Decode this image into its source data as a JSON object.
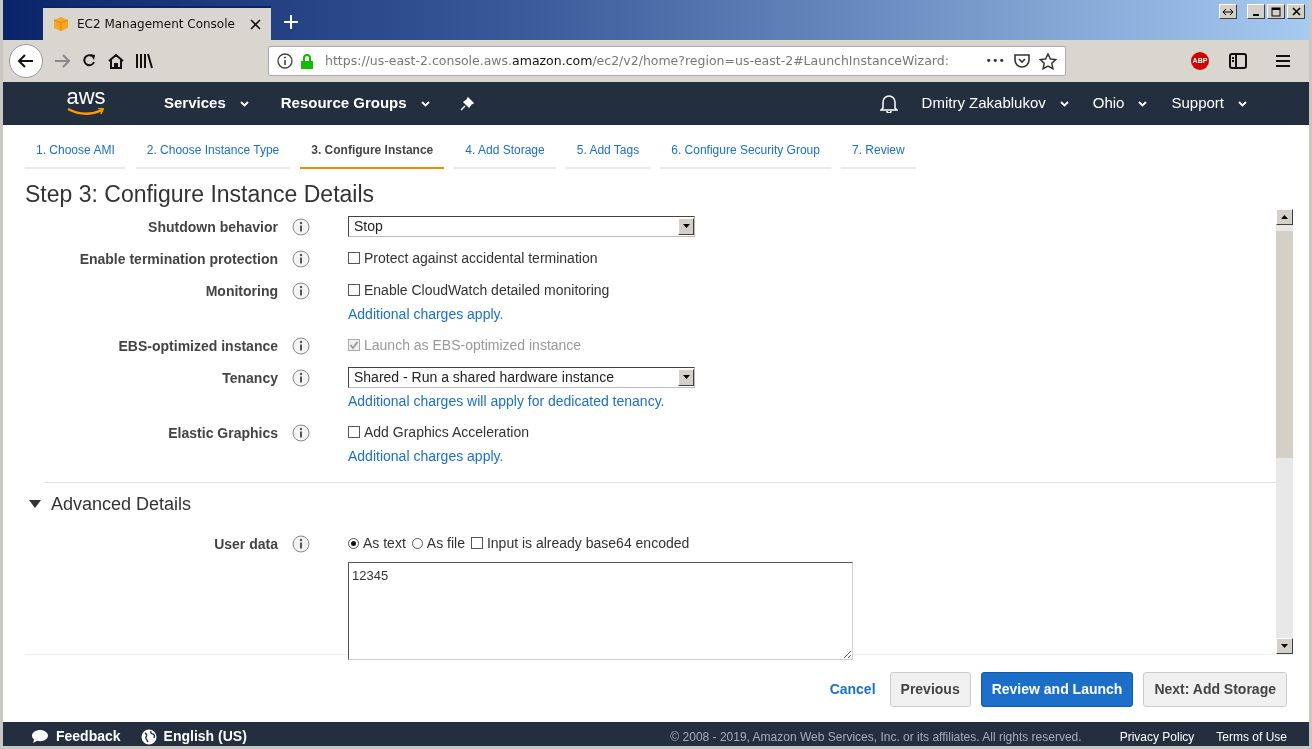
{
  "browser": {
    "tabs": [
      {
        "title": "EC2 Management Console",
        "selected": true
      }
    ],
    "url_parts": [
      {
        "text": "https://us-east-2.console.aws.",
        "emphasized": false
      },
      {
        "text": "amazon.com",
        "emphasized": true
      },
      {
        "text": "/ec2/v2/home?region=us-east-2#LaunchInstanceWizard:",
        "emphasized": false
      }
    ],
    "page_actions": "•••",
    "extension_badge": "ABP"
  },
  "aws_nav": {
    "logo": "aws",
    "menus": [
      {
        "label": "Services"
      },
      {
        "label": "Resource Groups"
      }
    ],
    "account_menus": [
      {
        "label": "Dmitry Zakablukov"
      },
      {
        "label": "Ohio"
      },
      {
        "label": "Support"
      }
    ]
  },
  "wizard_steps": [
    {
      "label": "1. Choose AMI",
      "selected": false
    },
    {
      "label": "2. Choose Instance Type",
      "selected": false
    },
    {
      "label": "3. Configure Instance",
      "selected": true
    },
    {
      "label": "4. Add Storage",
      "selected": false
    },
    {
      "label": "5. Add Tags",
      "selected": false
    },
    {
      "label": "6. Configure Security Group",
      "selected": false
    },
    {
      "label": "7. Review",
      "selected": false
    }
  ],
  "heading": "Step 3: Configure Instance Details",
  "form_rows": [
    {
      "label": "Shutdown behavior",
      "kind": "select",
      "value": "Stop"
    },
    {
      "label": "Enable termination protection",
      "kind": "checkbox",
      "option": "Protect against accidental termination",
      "checked": false,
      "disabled": false
    },
    {
      "label": "Monitoring",
      "kind": "checkbox",
      "option": "Enable CloudWatch detailed monitoring",
      "checked": false,
      "disabled": false,
      "note": "Additional charges apply."
    },
    {
      "label": "EBS-optimized instance",
      "kind": "checkbox",
      "option": "Launch as EBS-optimized instance",
      "checked": true,
      "disabled": true
    },
    {
      "label": "Tenancy",
      "kind": "select",
      "value": "Shared - Run a shared hardware instance",
      "note": "Additional charges will apply for dedicated tenancy."
    },
    {
      "label": "Elastic Graphics",
      "kind": "checkbox",
      "option": "Add Graphics Acceleration",
      "checked": false,
      "disabled": false,
      "note": "Additional charges apply."
    }
  ],
  "advanced": {
    "title": "Advanced Details",
    "expanded": true,
    "user_data": {
      "label": "User data",
      "options": [
        {
          "kind": "radio",
          "label": "As text",
          "selected": true
        },
        {
          "kind": "radio",
          "label": "As file",
          "selected": false
        },
        {
          "kind": "checkbox",
          "label": "Input is already base64 encoded",
          "checked": false
        }
      ],
      "value": "12345"
    }
  },
  "actions": {
    "cancel": "Cancel",
    "buttons": [
      {
        "label": "Previous",
        "kind": "secondary"
      },
      {
        "label": "Review and Launch",
        "kind": "primary"
      },
      {
        "label": "Next: Add Storage",
        "kind": "secondary"
      }
    ]
  },
  "footer": {
    "feedback": "Feedback",
    "language": "English (US)",
    "copyright": "© 2008 - 2019, Amazon Web Services, Inc. or its affiliates. All rights reserved.",
    "links": [
      "Privacy Policy",
      "Terms of Use"
    ]
  }
}
